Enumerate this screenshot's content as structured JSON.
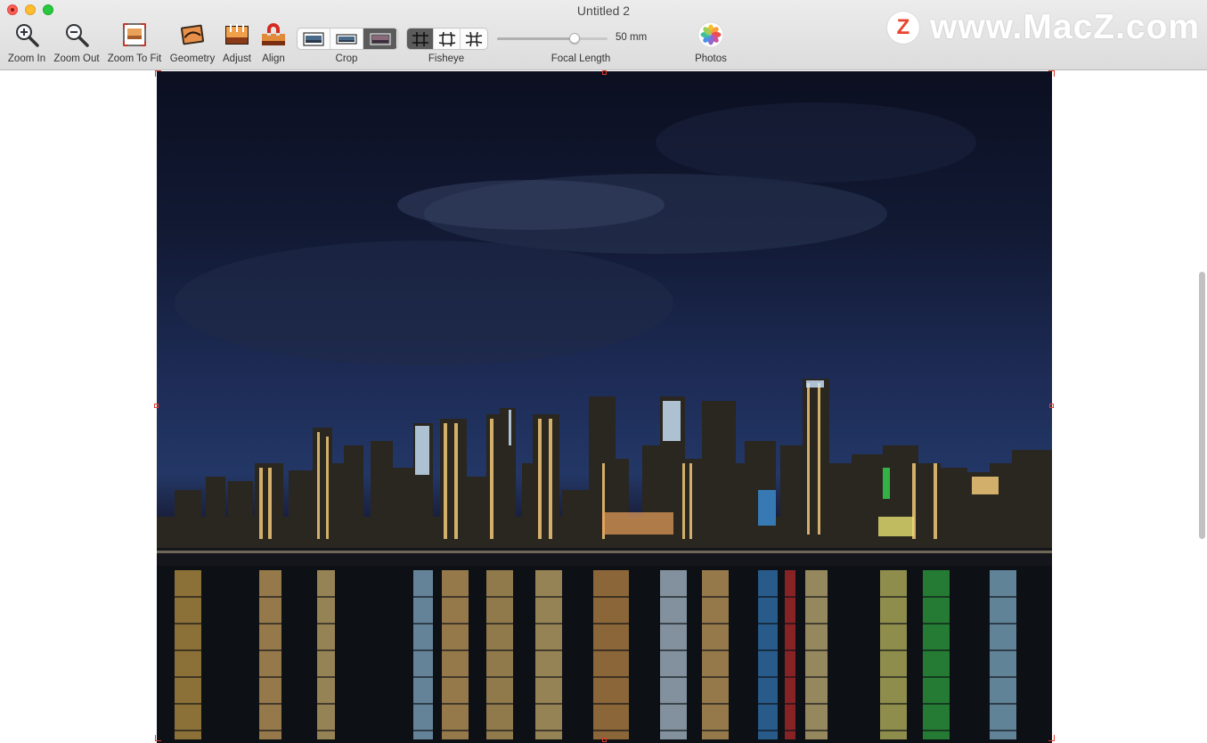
{
  "window": {
    "title": "Untitled 2"
  },
  "toolbar": {
    "zoom_in": "Zoom In",
    "zoom_out": "Zoom Out",
    "zoom_to_fit": "Zoom To Fit",
    "geometry": "Geometry",
    "adjust": "Adjust",
    "align": "Align",
    "crop": "Crop",
    "fisheye": "Fisheye",
    "focal_length": "Focal Length",
    "focal_value": "50 mm",
    "focal_level": 0.72,
    "photos": "Photos"
  },
  "watermark": {
    "badge": "Z",
    "text": "www.MacZ.com"
  },
  "colors": {
    "handle": "#e03a2f",
    "segment_selected": "#5b5b5b"
  }
}
